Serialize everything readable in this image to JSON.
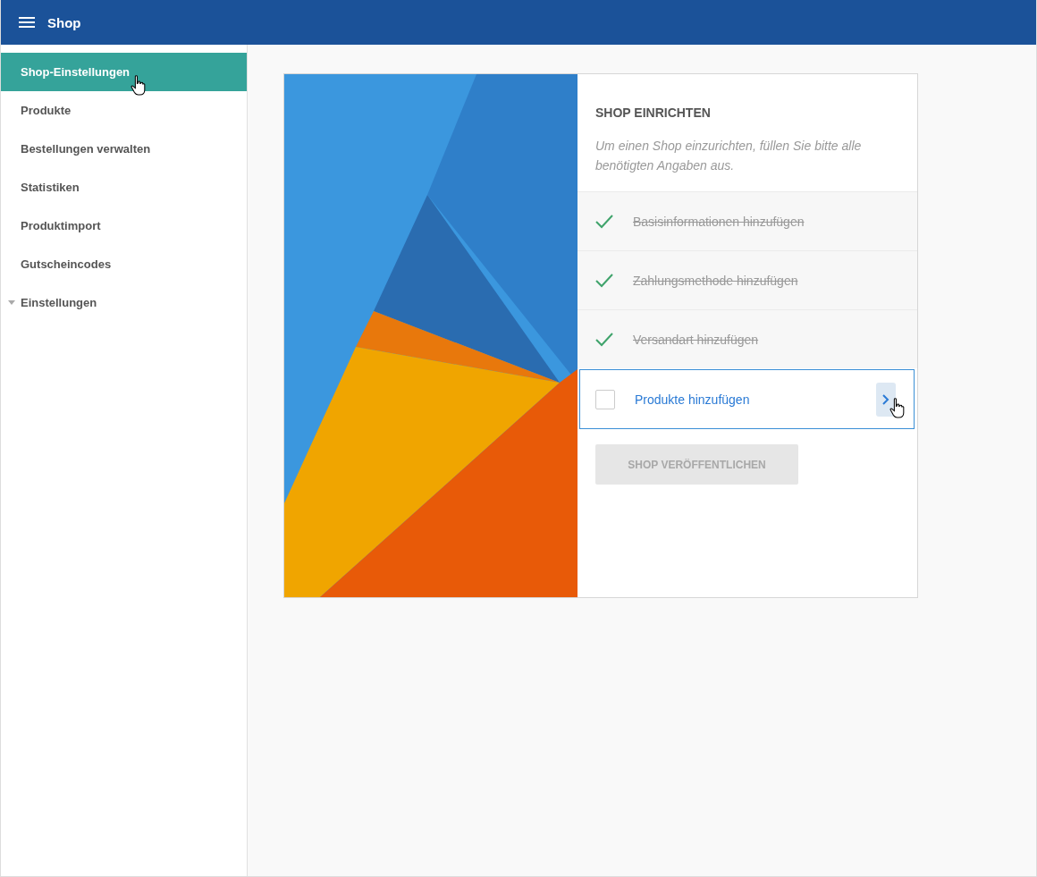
{
  "app_bar": {
    "title": "Shop"
  },
  "sidebar": {
    "items": [
      {
        "label": "Shop-Einstellungen",
        "selected": true,
        "kind": "link"
      },
      {
        "label": "Produkte",
        "selected": false,
        "kind": "link"
      },
      {
        "label": "Bestellungen verwalten",
        "selected": false,
        "kind": "link"
      },
      {
        "label": "Statistiken",
        "selected": false,
        "kind": "link"
      },
      {
        "label": "Produktimport",
        "selected": false,
        "kind": "link"
      },
      {
        "label": "Gutscheincodes",
        "selected": false,
        "kind": "link"
      },
      {
        "label": "Einstellungen",
        "selected": false,
        "kind": "group"
      }
    ]
  },
  "setup_card": {
    "title": "SHOP EINRICHTEN",
    "description": "Um einen Shop einzurichten, füllen Sie bitte alle benötigten Angaben aus.",
    "steps": [
      {
        "label": "Basisinformationen hinzufügen",
        "done": true,
        "selected": false
      },
      {
        "label": "Zahlungsmethode hinzufügen",
        "done": true,
        "selected": false
      },
      {
        "label": "Versandart hinzufügen",
        "done": true,
        "selected": false
      },
      {
        "label": "Produkte hinzufügen",
        "done": false,
        "selected": true
      }
    ],
    "publish_button": {
      "label": "SHOP VERÖFFENTLICHEN",
      "disabled": true
    }
  }
}
